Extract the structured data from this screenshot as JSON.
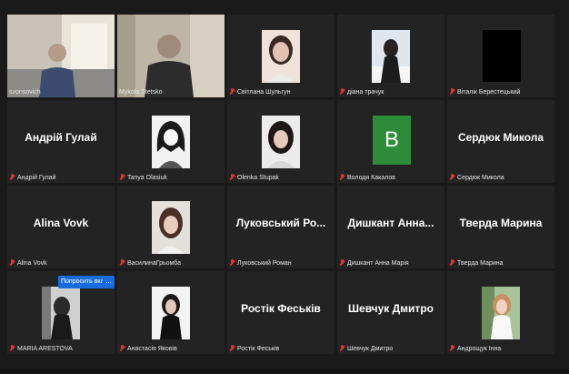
{
  "participants": [
    {
      "label": "svonsovich",
      "type": "video",
      "muted": false,
      "active": false
    },
    {
      "label": "Mykola Stetsko",
      "type": "video",
      "muted": false,
      "active": true
    },
    {
      "label": "Світлана Шульгун",
      "type": "photo",
      "muted": true
    },
    {
      "label": "діана трачук",
      "type": "photo",
      "muted": true
    },
    {
      "label": "Віталік Берестецький",
      "type": "black",
      "muted": true
    },
    {
      "label": "Андрій Гулай",
      "big": "Андрій Гулай",
      "type": "name",
      "muted": true
    },
    {
      "label": "Tanya Olasiuk",
      "type": "photo",
      "muted": true
    },
    {
      "label": "Olenka Stupak",
      "type": "photo",
      "muted": true
    },
    {
      "label": "Володя Какалов",
      "type": "avatar",
      "avatar_letter": "B",
      "muted": true
    },
    {
      "label": "Сердюк Микола",
      "big": "Сердюк Микола",
      "type": "name",
      "muted": true
    },
    {
      "label": "Alina Vovk",
      "big": "Alina Vovk",
      "type": "name",
      "muted": true
    },
    {
      "label": "ВасилинаГрьомба",
      "type": "photo",
      "muted": true
    },
    {
      "label": "Луковський Роман",
      "big": "Луковський Ро...",
      "type": "name",
      "muted": true
    },
    {
      "label": "Дишкант Анна Марія",
      "big": "Дишкант Анна...",
      "type": "name",
      "muted": true
    },
    {
      "label": "Тверда Марина",
      "big": "Тверда Марина",
      "type": "name",
      "muted": true
    },
    {
      "label": "MARIA ARESTOVA",
      "type": "photo",
      "muted": true
    },
    {
      "label": "Анастасія Яковів",
      "type": "photo",
      "muted": true
    },
    {
      "label": "Ростік Феськів",
      "big": "Ростік Феськів",
      "type": "name",
      "muted": true
    },
    {
      "label": "Шевчук Дмитро",
      "big": "Шевчук Дмитро",
      "type": "name",
      "muted": true
    },
    {
      "label": "Андрощук Інна",
      "type": "photo",
      "muted": true
    }
  ],
  "controls": {
    "ask_unmute_label": "Попросить вкл",
    "more_label": "..."
  },
  "colors": {
    "background": "#1a1a1a",
    "tile": "#232323",
    "active_border": "#d8e65a",
    "muted_icon": "#dd3333",
    "button": "#1a6cdc"
  }
}
